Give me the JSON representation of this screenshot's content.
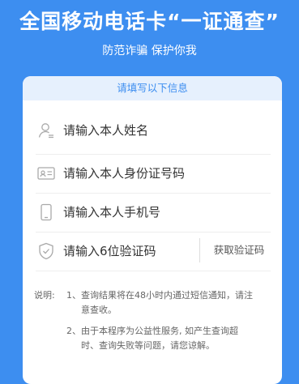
{
  "banner": {
    "title": "全国移动电话卡“一证通查”",
    "subtitle": "防范诈骗 保护你我"
  },
  "form": {
    "header": "请填写以下信息",
    "name_placeholder": "请输入本人姓名",
    "id_placeholder": "请输入本人身份证号码",
    "phone_placeholder": "请输入本人手机号",
    "code_placeholder": "请输入6位验证码",
    "get_code_label": "获取验证码"
  },
  "notes": {
    "label": "说明:",
    "item1_line1": "1、查询结果将在48小时内通过短信通知，请注",
    "item1_line2": "意查收。",
    "item2_line1": "2、由于本程序为公益性服务, 如产生查询超",
    "item2_line2": "时、查询失败等问题，请您谅解。"
  },
  "icons": {
    "name": "person-icon",
    "id": "id-card-icon",
    "phone": "phone-icon",
    "code": "shield-check-icon"
  },
  "colors": {
    "brand": "#3d8ef0",
    "header_bg": "#e6f0fd"
  }
}
